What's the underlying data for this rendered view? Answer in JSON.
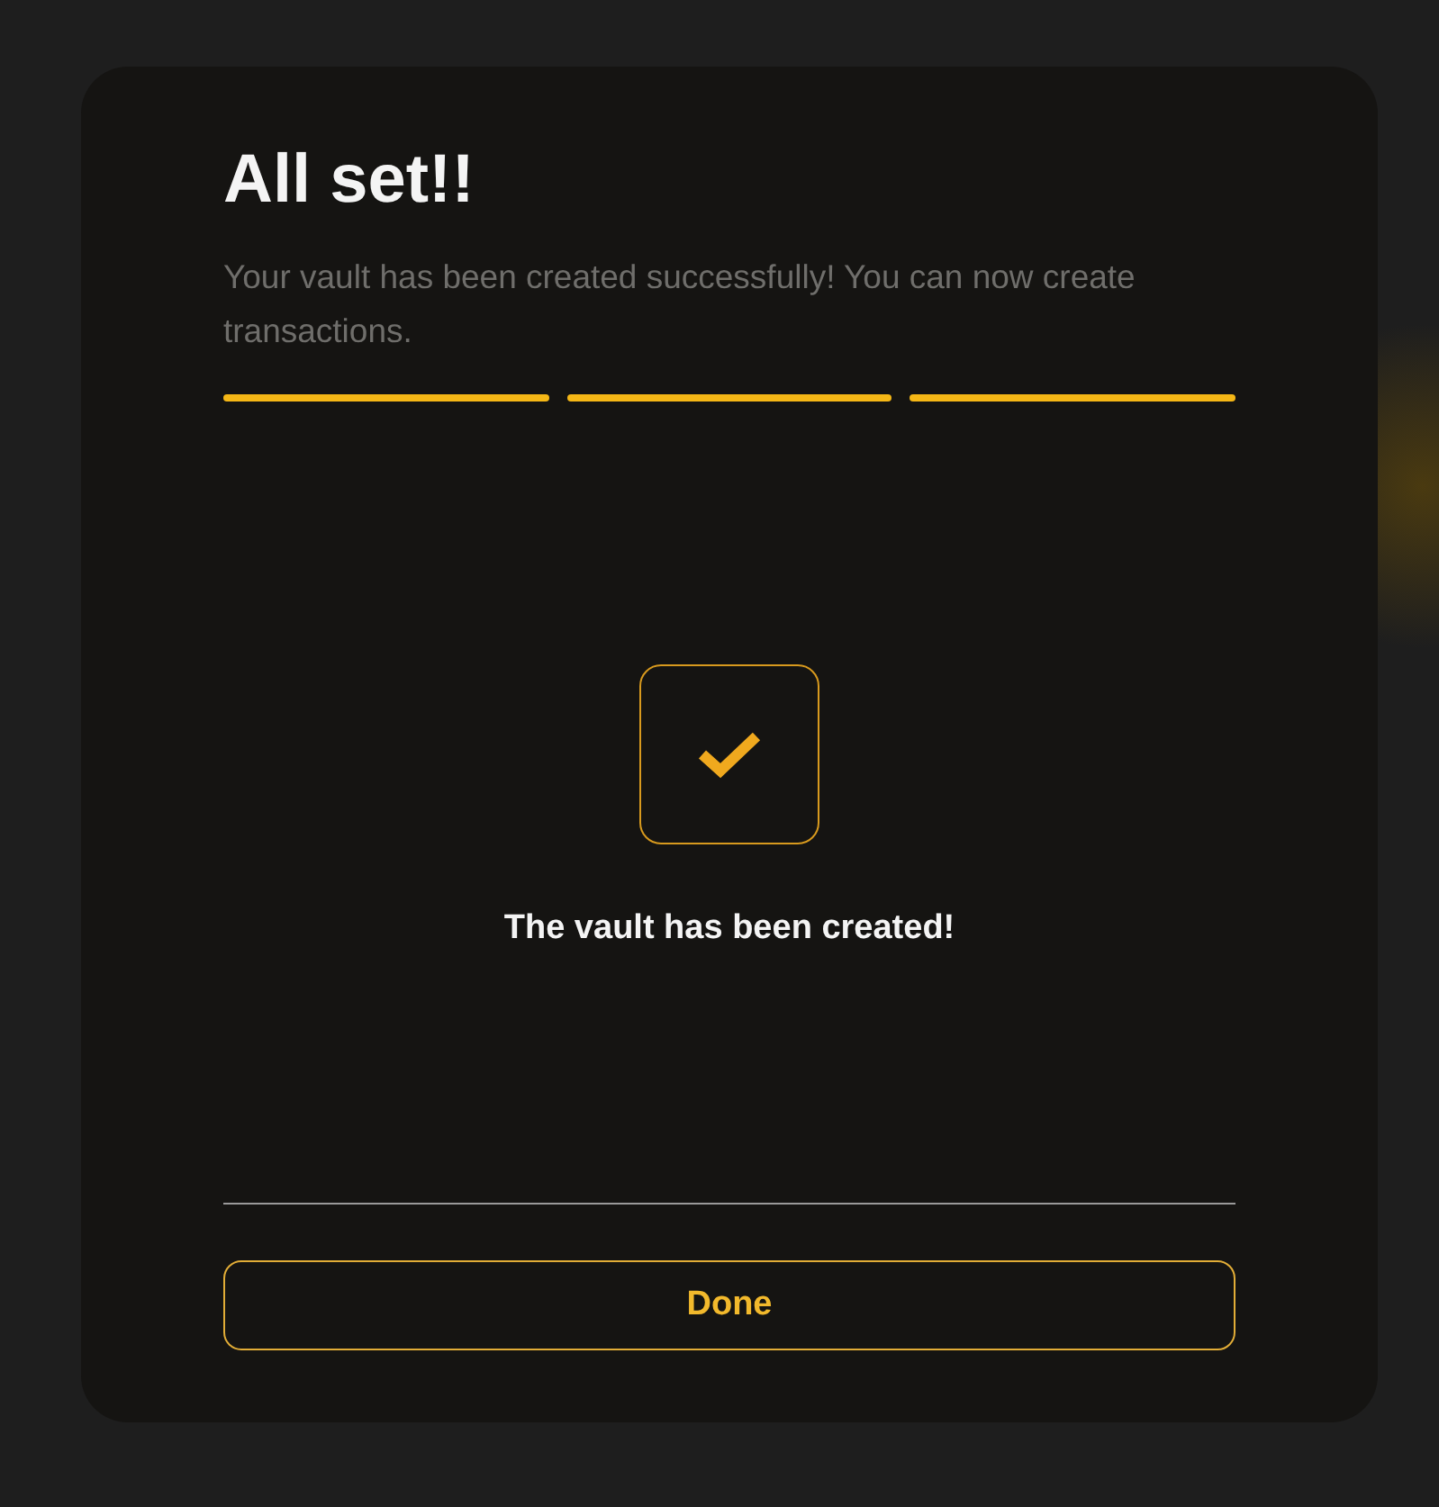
{
  "dialog": {
    "title": "All set!!",
    "subtitle": "Your vault has been created successfully! You can now create transactions.",
    "steps": [
      {
        "done": true
      },
      {
        "done": true
      },
      {
        "done": true
      }
    ],
    "status": {
      "checked": true,
      "message": "The vault has been created!"
    },
    "buttons": [
      {
        "label": "Done"
      }
    ]
  }
}
